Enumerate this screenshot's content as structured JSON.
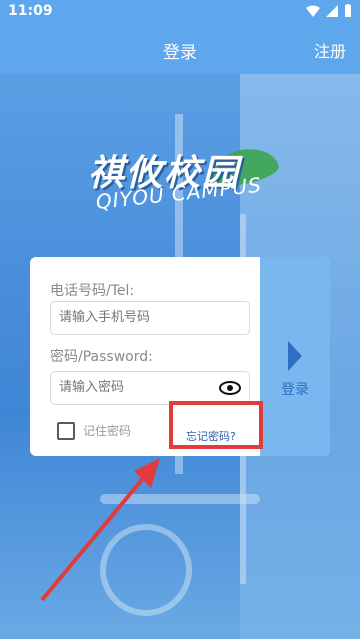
{
  "status": {
    "time": "11:09"
  },
  "appbar": {
    "title": "登录",
    "register": "注册"
  },
  "logo": {
    "cn": "祺攸校园",
    "en": "QIYOU CAMPUS"
  },
  "form": {
    "phone_label": "电话号码/Tel:",
    "phone_placeholder": "请输入手机号码",
    "password_label": "密码/Password:",
    "password_placeholder": "请输入密码",
    "remember_label": "记住密码",
    "forgot_label": "忘记密码?",
    "submit_label": "登录"
  },
  "colors": {
    "accent": "#5ea7ec",
    "highlight": "#e23b3b"
  }
}
